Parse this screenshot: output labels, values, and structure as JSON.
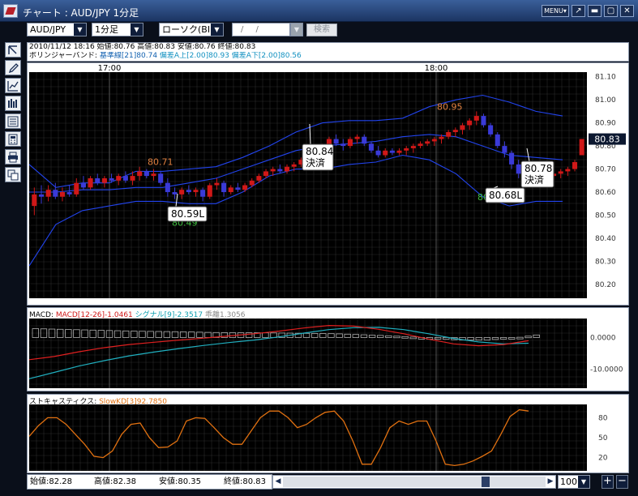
{
  "window": {
    "title": "チャート : AUD/JPY 1分足",
    "menu_label": "MENU▾",
    "buttons": [
      "↗",
      "▬",
      "▢",
      "✕"
    ]
  },
  "toolbar": {
    "pair": "AUD/JPY",
    "interval": "1分足",
    "chart_type": "ローソク(BID)",
    "date_placeholder": "/ /",
    "search_label": "検索"
  },
  "sidebar": {
    "tools": [
      "cursor-tool-icon",
      "pencil-icon",
      "line-chart-icon",
      "bar-chart-icon",
      "list-icon",
      "calculator-icon",
      "print-icon",
      "copy-icon"
    ]
  },
  "info": {
    "line1": "2010/11/12 18:16  始値:80.76  高値:80.83  安値:80.76  終値:80.83",
    "bb_label": "ボリンジャーバンド: ",
    "bb_mid": "基準線[21]80.74",
    "bb_up": "  偏差A上[2.00]80.93  偏差A下[2.00]80.56"
  },
  "price_chart": {
    "time_labels": [
      "17:00",
      "18:00"
    ],
    "y_ticks": [
      "81.10",
      "81.00",
      "80.90",
      "80.80",
      "80.70",
      "80.60",
      "80.50",
      "80.40",
      "80.30",
      "80.20"
    ],
    "y_values": [
      81.1,
      81.0,
      80.9,
      80.8,
      80.7,
      80.6,
      80.5,
      80.4,
      80.3,
      80.2
    ],
    "current_price": "80.83",
    "candles": [
      [
        80.54,
        80.62,
        80.5,
        80.59
      ],
      [
        80.59,
        80.63,
        80.55,
        80.58
      ],
      [
        80.58,
        80.63,
        80.56,
        80.61
      ],
      [
        80.61,
        80.64,
        80.57,
        80.58
      ],
      [
        80.58,
        80.62,
        80.56,
        80.6
      ],
      [
        80.6,
        80.63,
        80.58,
        80.59
      ],
      [
        80.59,
        80.66,
        80.58,
        80.64
      ],
      [
        80.64,
        80.67,
        80.61,
        80.62
      ],
      [
        80.62,
        80.67,
        80.61,
        80.66
      ],
      [
        80.66,
        80.68,
        80.63,
        80.64
      ],
      [
        80.64,
        80.67,
        80.62,
        80.66
      ],
      [
        80.66,
        80.68,
        80.64,
        80.65
      ],
      [
        80.65,
        80.68,
        80.63,
        80.67
      ],
      [
        80.67,
        80.69,
        80.64,
        80.65
      ],
      [
        80.65,
        80.69,
        80.63,
        80.67
      ],
      [
        80.67,
        80.71,
        80.65,
        80.69
      ],
      [
        80.69,
        80.7,
        80.66,
        80.67
      ],
      [
        80.67,
        80.7,
        80.65,
        80.68
      ],
      [
        80.68,
        80.69,
        80.63,
        80.64
      ],
      [
        80.64,
        80.66,
        80.58,
        80.6
      ],
      [
        80.6,
        80.62,
        80.57,
        80.59
      ],
      [
        80.59,
        80.62,
        80.57,
        80.61
      ],
      [
        80.61,
        80.63,
        80.59,
        80.6
      ],
      [
        80.6,
        80.62,
        80.58,
        80.61
      ],
      [
        80.61,
        80.62,
        80.56,
        80.58
      ],
      [
        80.58,
        80.64,
        80.57,
        80.63
      ],
      [
        80.63,
        80.66,
        80.61,
        80.64
      ],
      [
        80.64,
        80.65,
        80.58,
        80.6
      ],
      [
        80.6,
        80.63,
        80.59,
        80.62
      ],
      [
        80.62,
        80.64,
        80.6,
        80.61
      ],
      [
        80.61,
        80.64,
        80.6,
        80.63
      ],
      [
        80.63,
        80.66,
        80.62,
        80.65
      ],
      [
        80.65,
        80.68,
        80.64,
        80.67
      ],
      [
        80.67,
        80.7,
        80.66,
        80.69
      ],
      [
        80.69,
        80.71,
        80.67,
        80.7
      ],
      [
        80.7,
        80.72,
        80.68,
        80.69
      ],
      [
        80.69,
        80.72,
        80.68,
        80.71
      ],
      [
        80.71,
        80.73,
        80.69,
        80.72
      ],
      [
        80.72,
        80.75,
        80.71,
        80.74
      ],
      [
        80.74,
        80.77,
        80.73,
        80.76
      ],
      [
        80.76,
        80.79,
        80.75,
        80.78
      ],
      [
        80.78,
        80.81,
        80.76,
        80.8
      ],
      [
        80.8,
        80.84,
        80.79,
        80.83
      ],
      [
        80.83,
        80.85,
        80.8,
        80.81
      ],
      [
        80.81,
        80.83,
        80.78,
        80.8
      ],
      [
        80.8,
        80.84,
        80.79,
        80.83
      ],
      [
        80.83,
        80.85,
        80.81,
        80.84
      ],
      [
        80.84,
        80.85,
        80.8,
        80.81
      ],
      [
        80.81,
        80.82,
        80.77,
        80.78
      ],
      [
        80.78,
        80.8,
        80.75,
        80.76
      ],
      [
        80.76,
        80.79,
        80.75,
        80.78
      ],
      [
        80.78,
        80.79,
        80.76,
        80.77
      ],
      [
        80.77,
        80.79,
        80.76,
        80.78
      ],
      [
        80.78,
        80.8,
        80.76,
        80.79
      ],
      [
        80.79,
        80.81,
        80.77,
        80.8
      ],
      [
        80.8,
        80.82,
        80.79,
        80.81
      ],
      [
        80.81,
        80.83,
        80.8,
        80.82
      ],
      [
        80.82,
        80.84,
        80.8,
        80.83
      ],
      [
        80.83,
        80.85,
        80.81,
        80.84
      ],
      [
        80.84,
        80.87,
        80.83,
        80.86
      ],
      [
        80.86,
        80.88,
        80.84,
        80.87
      ],
      [
        80.87,
        80.9,
        80.85,
        80.89
      ],
      [
        80.89,
        80.92,
        80.87,
        80.91
      ],
      [
        80.91,
        80.95,
        80.89,
        80.93
      ],
      [
        80.93,
        80.94,
        80.88,
        80.89
      ],
      [
        80.89,
        80.9,
        80.84,
        80.85
      ],
      [
        80.85,
        80.86,
        80.79,
        80.8
      ],
      [
        80.8,
        80.82,
        80.75,
        80.77
      ],
      [
        80.77,
        80.78,
        80.7,
        80.72
      ],
      [
        80.72,
        80.74,
        80.66,
        80.68
      ],
      [
        80.68,
        80.69,
        80.64,
        80.66
      ],
      [
        80.66,
        80.68,
        80.62,
        80.64
      ],
      [
        80.64,
        80.66,
        80.62,
        80.65
      ],
      [
        80.65,
        80.68,
        80.63,
        80.67
      ],
      [
        80.67,
        80.69,
        80.65,
        80.68
      ],
      [
        80.68,
        80.7,
        80.66,
        80.69
      ],
      [
        80.69,
        80.71,
        80.67,
        80.7
      ],
      [
        80.7,
        80.74,
        80.69,
        80.73
      ],
      [
        80.76,
        80.83,
        80.76,
        80.83
      ]
    ],
    "band_upper": [
      80.72,
      80.62,
      80.64,
      80.64,
      80.69,
      80.69,
      80.7,
      80.71,
      80.75,
      80.8,
      80.86,
      80.9,
      80.91,
      80.91,
      80.92,
      80.97,
      81.0,
      81.02,
      80.99,
      80.95,
      80.93
    ],
    "band_mid": [
      80.6,
      80.6,
      80.61,
      80.61,
      80.62,
      80.62,
      80.64,
      80.66,
      80.7,
      80.74,
      80.78,
      80.8,
      80.81,
      80.82,
      80.84,
      80.85,
      80.84,
      80.8,
      80.76,
      80.75,
      80.74
    ],
    "band_lower": [
      80.28,
      80.46,
      80.52,
      80.54,
      80.56,
      80.56,
      80.55,
      80.55,
      80.6,
      80.67,
      80.7,
      80.7,
      80.72,
      80.73,
      80.76,
      80.74,
      80.68,
      80.58,
      80.54,
      80.56,
      80.56
    ],
    "annotations": [
      {
        "label": "80.71",
        "price": 80.71,
        "color": "#e08040"
      },
      {
        "label": "80.95",
        "price": 80.95,
        "color": "#e08040"
      },
      {
        "label": "80.49",
        "price": 80.49,
        "color": "#40c040"
      },
      {
        "label": "80.6",
        "price": 80.6,
        "color": "#40c040"
      }
    ],
    "callouts": [
      {
        "line1": "80.59L",
        "line2": ""
      },
      {
        "line1": "80.84",
        "line2": "決済"
      },
      {
        "line1": "80.68L",
        "line2": ""
      },
      {
        "line1": "80.78",
        "line2": "決済"
      }
    ]
  },
  "macd_chart": {
    "label": "MACD: ",
    "macd_text": "MACD[12-26]-1.0461",
    "signal_text": "  シグナル[9]-2.3517",
    "diff_text": "  乖離1.3056",
    "y_ticks": [
      "0.0000",
      "-10.0000"
    ],
    "y_values": [
      0,
      -10
    ],
    "macd": [
      -7,
      -6,
      -4.5,
      -3.2,
      -2.2,
      -1.5,
      -0.8,
      -0.2,
      0.5,
      1.2,
      2.0,
      3.0,
      3.8,
      3.6,
      2.6,
      1.2,
      -0.5,
      -2.0,
      -2.6,
      -2.2,
      -1.0
    ],
    "signal": [
      -13,
      -11,
      -9,
      -7.3,
      -5.8,
      -4.6,
      -3.5,
      -2.5,
      -1.6,
      -0.8,
      0.2,
      1.4,
      2.5,
      3.1,
      3.2,
      2.5,
      1.2,
      -0.3,
      -1.4,
      -2.0,
      -1.8
    ],
    "hist": [
      2.8,
      2.6,
      2.4,
      2.2,
      2.0,
      1.9,
      1.8,
      1.6,
      1.5,
      1.5,
      1.4,
      1.3,
      1.2,
      0.9,
      0.6,
      0.2,
      -0.4,
      -0.8,
      -0.8,
      -0.3,
      0.8
    ]
  },
  "stoch_chart": {
    "label": "ストキャスティクス: ",
    "slow_text": "SlowKD[3]92.7850",
    "y_ticks": [
      "80",
      "50",
      "20"
    ],
    "y_values": [
      80,
      50,
      20
    ],
    "series": [
      52,
      68,
      80,
      80,
      70,
      55,
      40,
      22,
      20,
      30,
      55,
      70,
      72,
      50,
      35,
      36,
      45,
      75,
      80,
      79,
      65,
      50,
      40,
      40,
      60,
      80,
      90,
      90,
      80,
      65,
      70,
      80,
      88,
      90,
      75,
      45,
      10,
      10,
      35,
      65,
      75,
      70,
      75,
      75,
      45,
      10,
      8,
      10,
      15,
      22,
      30,
      55,
      82,
      92,
      90
    ]
  },
  "status": {
    "open": "始値:82.28",
    "high": "高値:82.38",
    "low": "安値:80.35",
    "close": "終値:80.83"
  },
  "zoom": {
    "value": "100"
  },
  "colors": {
    "up": "#d01818",
    "down": "#3a3ad8",
    "band": "#2244ee",
    "macd": "#e02020",
    "signal": "#20b0c0",
    "stoch": "#e07010",
    "grid": "#2a2a2a",
    "bg": "#000000"
  }
}
